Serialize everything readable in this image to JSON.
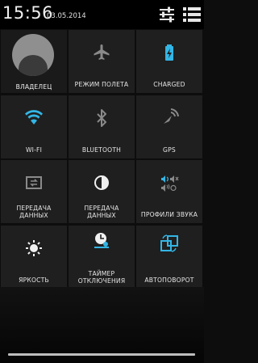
{
  "status": {
    "time": "15:56",
    "date": "03.05.2014"
  },
  "owner": {
    "label": "ВЛАДЕЛЕЦ"
  },
  "tiles": [
    {
      "label": "РЕЖИМ ПОЛЕТА",
      "icon": "airplane-icon",
      "state": "off"
    },
    {
      "label": "CHARGED",
      "icon": "battery-charging-icon",
      "state": "on"
    },
    {
      "label": "WI-FI",
      "icon": "wifi-icon",
      "state": "on"
    },
    {
      "label": "BLUETOOTH",
      "icon": "bluetooth-icon",
      "state": "off"
    },
    {
      "label": "GPS",
      "icon": "gps-icon",
      "state": "off"
    },
    {
      "label": "ПЕРЕДАЧА ДАННЫХ",
      "line1": "ПЕРЕДАЧА",
      "line2": "ДАННЫХ",
      "icon": "mobile-data-icon",
      "state": "off"
    },
    {
      "label": "ПЕРЕДАЧА ДАННЫХ",
      "line1": "ПЕРЕДАЧА",
      "line2": "ДАННЫХ",
      "icon": "screen-brightness-icon",
      "state": "on"
    },
    {
      "label": "ПРОФИЛИ ЗВУКА",
      "icon": "sound-profiles-icon",
      "state": "on"
    },
    {
      "label": "ЯРКОСТЬ",
      "icon": "brightness-icon",
      "state": "on"
    },
    {
      "label": "ТАЙМЕР ОТКЛЮЧЕНИЯ",
      "line1": "ТАЙМЕР",
      "line2": "ОТКЛЮЧЕНИЯ",
      "icon": "sleep-timer-icon",
      "state": "on"
    },
    {
      "label": "АВТОПОВОРОТ",
      "icon": "auto-rotate-icon",
      "state": "on"
    }
  ],
  "colors": {
    "accent": "#33b5e5",
    "inactive": "#8a8a8a",
    "tile_bg": "#1f1f1f"
  }
}
